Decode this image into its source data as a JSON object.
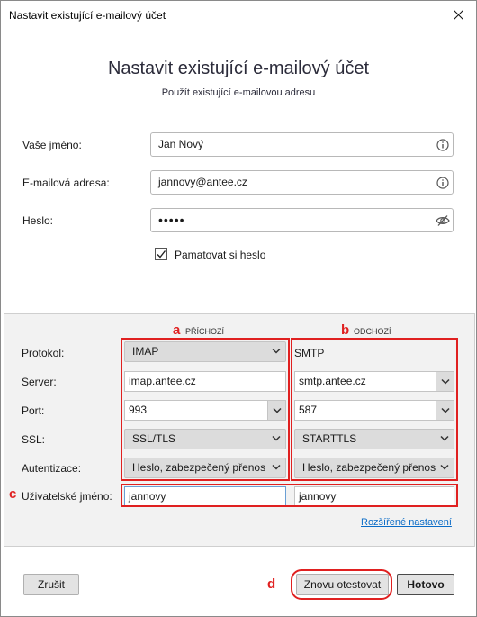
{
  "window": {
    "title": "Nastavit existující e-mailový účet"
  },
  "header": {
    "title": "Nastavit existující e-mailový účet",
    "subtitle": "Použít existující e-mailovou adresu"
  },
  "form": {
    "name_label": "Vaše jméno:",
    "name_value": "Jan Nový",
    "email_label": "E-mailová adresa:",
    "email_value": "jannovy@antee.cz",
    "password_label": "Heslo:",
    "password_value": "•••••",
    "remember_label": "Pamatovat si heslo",
    "remember_checked": true
  },
  "server": {
    "incoming_header": "PŘÍCHOZÍ",
    "outgoing_header": "ODCHOZÍ",
    "rows": {
      "protocol_label": "Protokol:",
      "server_label": "Server:",
      "port_label": "Port:",
      "ssl_label": "SSL:",
      "auth_label": "Autentizace:",
      "username_label": "Uživatelské jméno:"
    },
    "incoming": {
      "protocol": "IMAP",
      "server": "imap.antee.cz",
      "port": "993",
      "ssl": "SSL/TLS",
      "auth": "Heslo, zabezpečený přenos",
      "username": "jannovy"
    },
    "outgoing": {
      "protocol": "SMTP",
      "server": "smtp.antee.cz",
      "port": "587",
      "ssl": "STARTTLS",
      "auth": "Heslo, zabezpečený přenos",
      "username": "jannovy"
    },
    "advanced_link": "Rozšířené nastavení"
  },
  "annotations": {
    "a": "a",
    "b": "b",
    "c": "c",
    "d": "d",
    "color": "#e02020"
  },
  "buttons": {
    "cancel": "Zrušit",
    "retest": "Znovu otestovat",
    "done": "Hotovo"
  },
  "colors": {
    "link": "#0a6cc7",
    "accent_red": "#e02020",
    "panel_bg": "#f2f2f2"
  }
}
